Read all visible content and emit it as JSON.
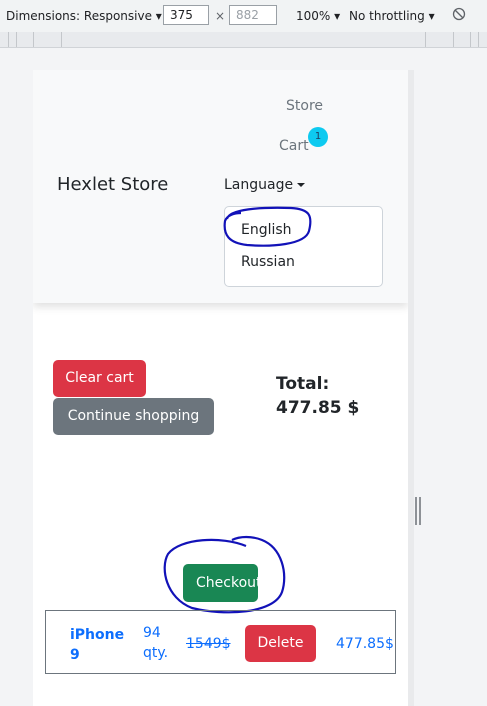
{
  "devtools": {
    "dimensions_label": "Dimensions: Responsive",
    "width_value": "375",
    "times_sign": "×",
    "height_value": "882",
    "zoom": "100%",
    "throttling": "No throttling"
  },
  "navbar": {
    "brand": "Hexlet Store",
    "store_link": "Store",
    "cart_link": "Cart",
    "cart_badge": "1",
    "language_toggle": "Language",
    "languages": [
      "English",
      "Russian"
    ]
  },
  "cart": {
    "clear_button": "Clear cart",
    "continue_button": "Continue shopping",
    "total_label": "Total:",
    "total_value": "477.85 $",
    "checkout_button": "Checkout",
    "item": {
      "name": "iPhone 9",
      "qty": "94 qty.",
      "old_price": "1549$",
      "delete_button": "Delete",
      "price": "477.85$"
    }
  },
  "colors": {
    "danger": "#dc3545",
    "secondary": "#6c757d",
    "success": "#198754",
    "info": "#0dcaf0",
    "link": "#0d6efd",
    "annotation": "#1212b8"
  }
}
